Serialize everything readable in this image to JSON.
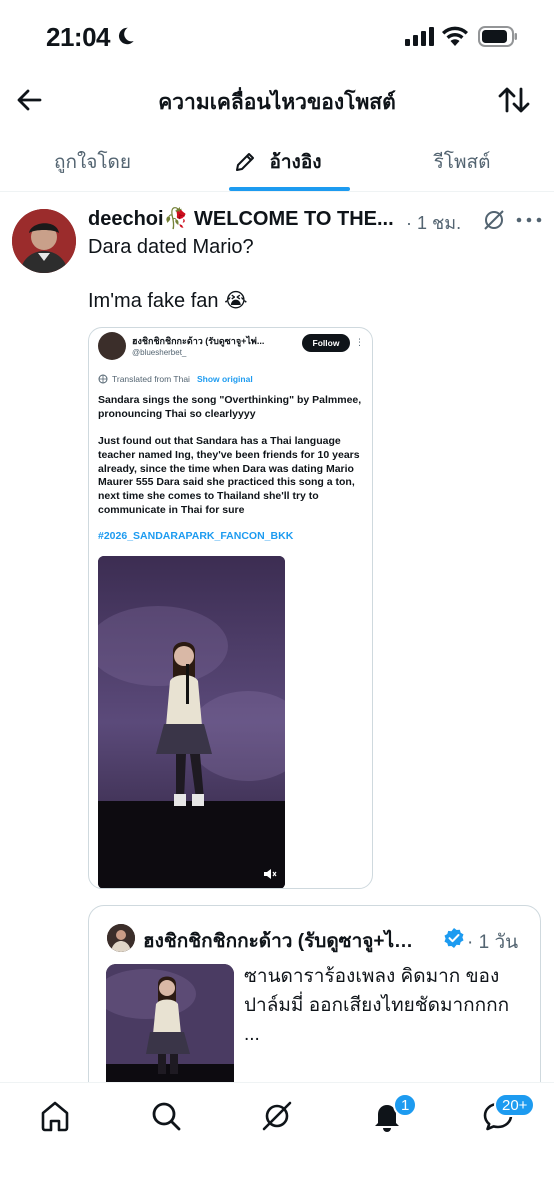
{
  "status": {
    "time": "21:04"
  },
  "header": {
    "title": "ความเคลื่อนไหวของโพสต์"
  },
  "tabs": [
    {
      "label": "ถูกใจโดย"
    },
    {
      "label": "อ้างอิง"
    },
    {
      "label": "รีโพสต์"
    }
  ],
  "post": {
    "author": "deechoi🥀 WELCOME TO THE...",
    "time": "· 1 ชม.",
    "text_line1": "Dara dated Mario?",
    "text_line2": "Im'ma fake fan 😭",
    "embed": {
      "name": "ฮงชิกชิกชิกกะด้าว (รับดูซาจู+ไพ่...",
      "handle": "@bluesherbet_",
      "follow_label": "Follow",
      "translated_label": "Translated from Thai",
      "show_original_label": "Show original",
      "text_p1": "Sandara sings the song \"Overthinking\" by Palmmee, pronouncing Thai so clearlyyyy",
      "text_p2": "Just found out that Sandara has a Thai language teacher named Ing, they've been friends for 10 years already, since the time when Dara was dating Mario Maurer 555 Dara said she practiced this song a ton, next time she comes to Thailand she'll try to communicate in Thai for sure",
      "hashtag": "#2026_SANDARAPARK_FANCON_BKK"
    },
    "quote": {
      "name": "ฮงชิกชิกชิกกะด้าว (รับดูซาจู+ไพ่...",
      "time": "· 1 วัน",
      "text": "ซานดาราร้องเพลง คิดมาก ของปาล์มมี่ ออกเสียงไทยชัดมากกกก",
      "ellipsis": "..."
    }
  },
  "nav": {
    "notifications_badge": "1",
    "messages_badge": "20+"
  },
  "colors": {
    "accent": "#1d9bf0",
    "text": "#0f1419",
    "muted": "#536471"
  }
}
